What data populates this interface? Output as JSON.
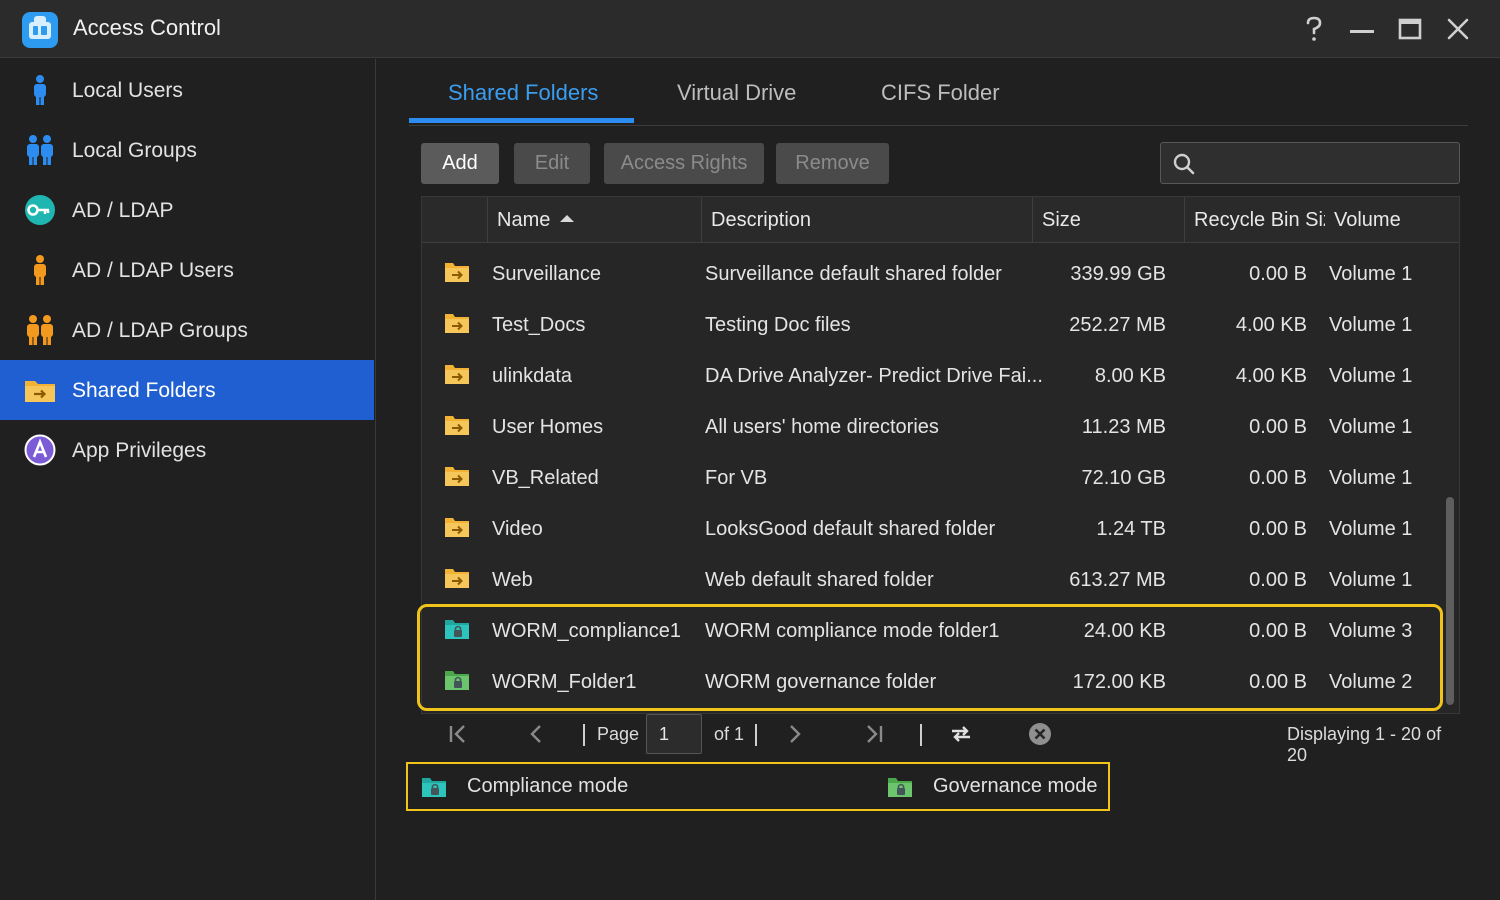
{
  "window": {
    "title": "Access Control",
    "help_icon": "question-mark-icon",
    "minimize_icon": "minimize-icon",
    "maximize_icon": "maximize-icon",
    "close_icon": "close-icon"
  },
  "sidebar": {
    "items": [
      {
        "label": "Local Users",
        "icon": "user-icon",
        "active": false
      },
      {
        "label": "Local Groups",
        "icon": "group-icon",
        "active": false
      },
      {
        "label": "AD / LDAP",
        "icon": "key-icon",
        "active": false
      },
      {
        "label": "AD / LDAP Users",
        "icon": "ad-user-icon",
        "active": false
      },
      {
        "label": "AD / LDAP Groups",
        "icon": "ad-group-icon",
        "active": false
      },
      {
        "label": "Shared Folders",
        "icon": "shared-folder-icon",
        "active": true
      },
      {
        "label": "App Privileges",
        "icon": "app-privileges-icon",
        "active": false
      }
    ]
  },
  "tabs": [
    {
      "label": "Shared Folders",
      "active": true
    },
    {
      "label": "Virtual Drive",
      "active": false
    },
    {
      "label": "CIFS Folder",
      "active": false
    }
  ],
  "toolbar": {
    "add": "Add",
    "edit": "Edit",
    "access_rights": "Access Rights",
    "remove": "Remove",
    "search_placeholder": ""
  },
  "table": {
    "columns": [
      "Name",
      "Description",
      "Size",
      "Recycle Bin Size",
      "Volume"
    ],
    "sort_column": "Name",
    "sort_direction": "ascending",
    "rows": [
      {
        "name": "Surveillance",
        "description": "Surveillance default shared folder",
        "size": "339.99 GB",
        "recycle": "0.00 B",
        "volume": "Volume 1",
        "icon": "folder"
      },
      {
        "name": "Test_Docs",
        "description": "Testing Doc files",
        "size": "252.27 MB",
        "recycle": "4.00 KB",
        "volume": "Volume 1",
        "icon": "folder"
      },
      {
        "name": "ulinkdata",
        "description": "DA Drive Analyzer- Predict Drive Fai...",
        "size": "8.00 KB",
        "recycle": "4.00 KB",
        "volume": "Volume 1",
        "icon": "folder"
      },
      {
        "name": "User Homes",
        "description": "All users' home directories",
        "size": "11.23 MB",
        "recycle": "0.00 B",
        "volume": "Volume 1",
        "icon": "folder"
      },
      {
        "name": "VB_Related",
        "description": "For VB",
        "size": "72.10 GB",
        "recycle": "0.00 B",
        "volume": "Volume 1",
        "icon": "folder"
      },
      {
        "name": "Video",
        "description": "LooksGood default shared folder",
        "size": "1.24 TB",
        "recycle": "0.00 B",
        "volume": "Volume 1",
        "icon": "folder"
      },
      {
        "name": "Web",
        "description": "Web default shared folder",
        "size": "613.27 MB",
        "recycle": "0.00 B",
        "volume": "Volume 1",
        "icon": "folder"
      },
      {
        "name": "WORM_compliance1",
        "description": "WORM compliance mode folder1",
        "size": "24.00 KB",
        "recycle": "0.00 B",
        "volume": "Volume 3",
        "icon": "worm-compliance"
      },
      {
        "name": "WORM_Folder1",
        "description": "WORM governance folder",
        "size": "172.00 KB",
        "recycle": "0.00 B",
        "volume": "Volume 2",
        "icon": "worm-governance"
      }
    ]
  },
  "pager": {
    "page_label": "Page",
    "page_value": "1",
    "of_label": "of 1",
    "display_text": "Displaying 1 - 20 of 20"
  },
  "legend": {
    "compliance": "Compliance mode",
    "governance": "Governance mode"
  },
  "colors": {
    "accent": "#2d8cf0",
    "active_sidebar": "#1f5fd1",
    "highlight": "#f0c419",
    "folder": "#f2b233",
    "compliance": "#1fa7a0",
    "governance": "#5cb85c"
  }
}
